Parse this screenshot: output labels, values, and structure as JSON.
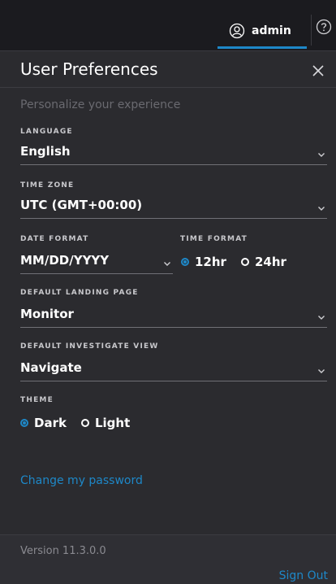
{
  "topbar": {
    "user_label": "admin",
    "user_icon": "user-circle-icon",
    "help_icon": "help-circle-icon",
    "accent": "#1e88c8"
  },
  "panel": {
    "title": "User Preferences",
    "close_icon": "close-icon",
    "subtitle": "Personalize your experience"
  },
  "fields": {
    "language": {
      "label": "LANGUAGE",
      "value": "English"
    },
    "time_zone": {
      "label": "TIME ZONE",
      "value": "UTC (GMT+00:00)"
    },
    "date_format": {
      "label": "DATE FORMAT",
      "value": "MM/DD/YYYY"
    },
    "time_format": {
      "label": "TIME FORMAT",
      "options": [
        "12hr",
        "24hr"
      ],
      "selected": "12hr"
    },
    "landing_page": {
      "label": "DEFAULT LANDING PAGE",
      "value": "Monitor"
    },
    "investigate_view": {
      "label": "DEFAULT INVESTIGATE VIEW",
      "value": "Navigate"
    },
    "theme": {
      "label": "THEME",
      "options": [
        "Dark",
        "Light"
      ],
      "selected": "Dark"
    }
  },
  "links": {
    "change_password": "Change my password"
  },
  "footer": {
    "version": "Version 11.3.0.0",
    "sign_out": "Sign Out"
  }
}
